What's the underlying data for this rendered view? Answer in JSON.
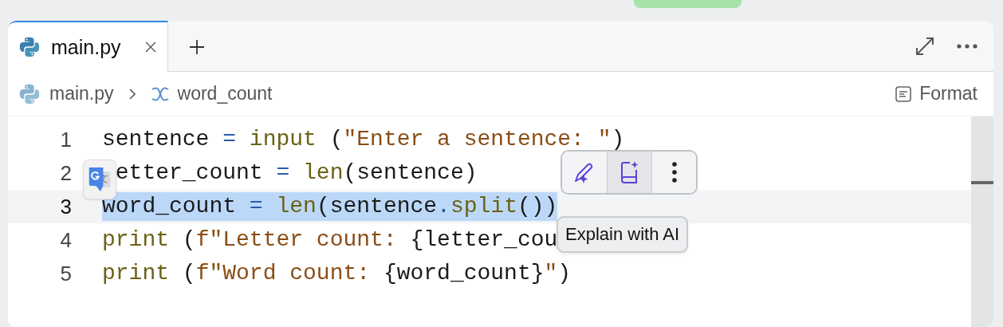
{
  "tabs": [
    {
      "label": "main.py",
      "selected": true,
      "closable": true
    }
  ],
  "breadcrumb": {
    "file": "main.py",
    "symbol": "word_count"
  },
  "format_button": "Format",
  "editor": {
    "lines": [
      {
        "number": "1",
        "selected": false,
        "translate_badge": false,
        "tokens": [
          {
            "text": "sentence ",
            "kind": "name"
          },
          {
            "text": "= ",
            "kind": "op"
          },
          {
            "text": "input",
            "kind": "fn"
          },
          {
            "text": " (",
            "kind": "name"
          },
          {
            "text": "\"Enter a sentence: \"",
            "kind": "str"
          },
          {
            "text": ")",
            "kind": "name"
          }
        ]
      },
      {
        "number": "2",
        "selected": false,
        "translate_badge": true,
        "tokens": [
          {
            "text": "etter_count ",
            "kind": "name"
          },
          {
            "text": "= ",
            "kind": "op"
          },
          {
            "text": "len",
            "kind": "fn"
          },
          {
            "text": "(sentence)",
            "kind": "name"
          }
        ]
      },
      {
        "number": "3",
        "selected": true,
        "translate_badge": false,
        "tokens": [
          {
            "text": "word_count ",
            "kind": "name"
          },
          {
            "text": "= ",
            "kind": "op"
          },
          {
            "text": "len",
            "kind": "fn"
          },
          {
            "text": "(sentence",
            "kind": "name"
          },
          {
            "text": ".",
            "kind": "op"
          },
          {
            "text": "split",
            "kind": "fn"
          },
          {
            "text": "())",
            "kind": "name"
          }
        ]
      },
      {
        "number": "4",
        "selected": false,
        "translate_badge": false,
        "tokens": [
          {
            "text": "print",
            "kind": "fn"
          },
          {
            "text": " (",
            "kind": "name"
          },
          {
            "text": "f\"Letter count: ",
            "kind": "str"
          },
          {
            "text": "{letter_cou",
            "kind": "name"
          }
        ]
      },
      {
        "number": "5",
        "selected": false,
        "translate_badge": false,
        "tokens": [
          {
            "text": "print",
            "kind": "fn"
          },
          {
            "text": " (",
            "kind": "name"
          },
          {
            "text": "f\"Word count: ",
            "kind": "str"
          },
          {
            "text": "{word_count}",
            "kind": "name"
          },
          {
            "text": "\"",
            "kind": "str"
          },
          {
            "text": ")",
            "kind": "name"
          }
        ]
      }
    ]
  },
  "popup_toolbar": {
    "buttons": [
      {
        "kind": "edit",
        "hovered": false
      },
      {
        "kind": "explain",
        "hovered": true
      },
      {
        "kind": "more",
        "hovered": false
      }
    ]
  },
  "tooltip": "Explain with AI"
}
